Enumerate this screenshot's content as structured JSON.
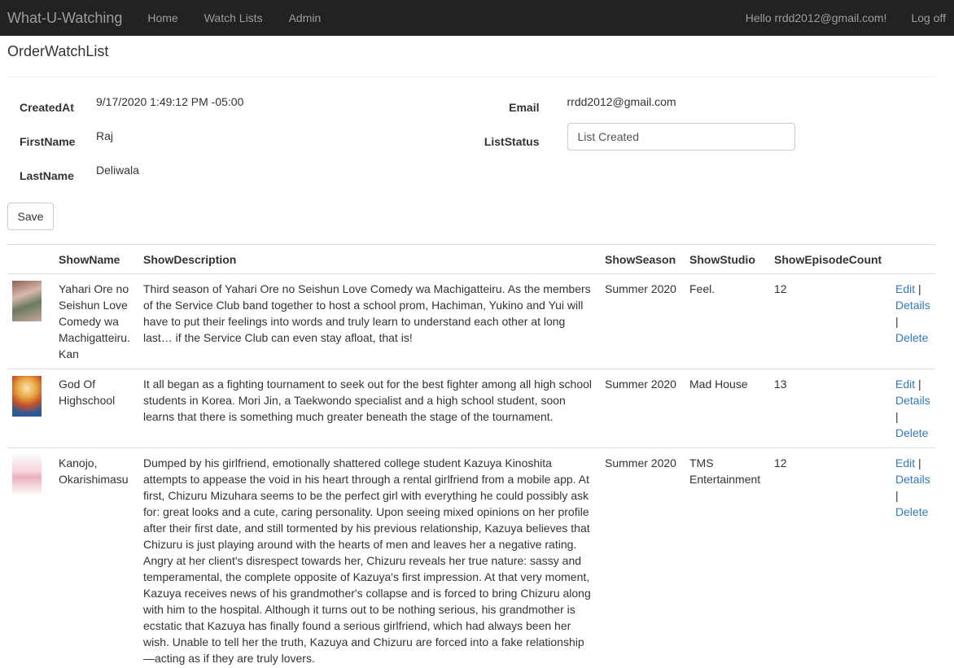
{
  "nav": {
    "brand": "What-U-Watching",
    "links": [
      "Home",
      "Watch Lists",
      "Admin"
    ],
    "greeting": "Hello rrdd2012@gmail.com!",
    "logoff": "Log off"
  },
  "page": {
    "title": "OrderWatchList"
  },
  "form": {
    "created_at_label": "CreatedAt",
    "created_at_value": "9/17/2020 1:49:12 PM -05:00",
    "first_name_label": "FirstName",
    "first_name_value": "Raj",
    "last_name_label": "LastName",
    "last_name_value": "Deliwala",
    "email_label": "Email",
    "email_value": "rrdd2012@gmail.com",
    "list_status_label": "ListStatus",
    "list_status_value": "List Created",
    "save_label": "Save"
  },
  "table": {
    "headers": [
      "ShowName",
      "ShowDescription",
      "ShowSeason",
      "ShowStudio",
      "ShowEpisodeCount"
    ],
    "rows": [
      {
        "name": "Yahari Ore no Seishun Love Comedy wa Machigatteiru. Kan",
        "description": "Third season of Yahari Ore no Seishun Love Comedy wa Machigatteiru. As the members of the Service Club band together to host a school prom, Hachiman, Yukino and Yui will have to put their feelings into words and truly learn to understand each other at long last… if the Service Club can even stay afloat, that is!",
        "season": "Summer 2020",
        "studio": "Feel.",
        "episodes": "12",
        "edit": "Edit",
        "details": "Details",
        "delete": "Delete"
      },
      {
        "name": "God Of Highschool",
        "description": "It all began as a fighting tournament to seek out for the best fighter among all high school students in Korea. Mori Jin, a Taekwondo specialist and a high school student, soon learns that there is something much greater beneath the stage of the tournament.",
        "season": "Summer 2020",
        "studio": "Mad House",
        "episodes": "13",
        "edit": "Edit",
        "details": "Details",
        "delete": "Delete"
      },
      {
        "name": "Kanojo, Okarishimasu",
        "description": "Dumped by his girlfriend, emotionally shattered college student Kazuya Kinoshita attempts to appease the void in his heart through a rental girlfriend from a mobile app. At first, Chizuru Mizuhara seems to be the perfect girl with everything he could possibly ask for: great looks and a cute, caring personality. Upon seeing mixed opinions on her profile after their first date, and still tormented by his previous relationship, Kazuya believes that Chizuru is just playing around with the hearts of men and leaves her a negative rating. Angry at her client's disrespect towards her, Chizuru reveals her true nature: sassy and temperamental, the complete opposite of Kazuya's first impression. At that very moment, Kazuya receives news of his grandmother's collapse and is forced to bring Chizuru along with him to the hospital. Although it turns out to be nothing serious, his grandmother is ecstatic that Kazuya has finally found a serious girlfriend, which had always been her wish. Unable to tell her the truth, Kazuya and Chizuru are forced into a fake relationship—acting as if they are truly lovers.",
        "season": "Summer 2020",
        "studio": "TMS Entertainment",
        "episodes": "12",
        "edit": "Edit",
        "details": "Details",
        "delete": "Delete"
      }
    ]
  }
}
